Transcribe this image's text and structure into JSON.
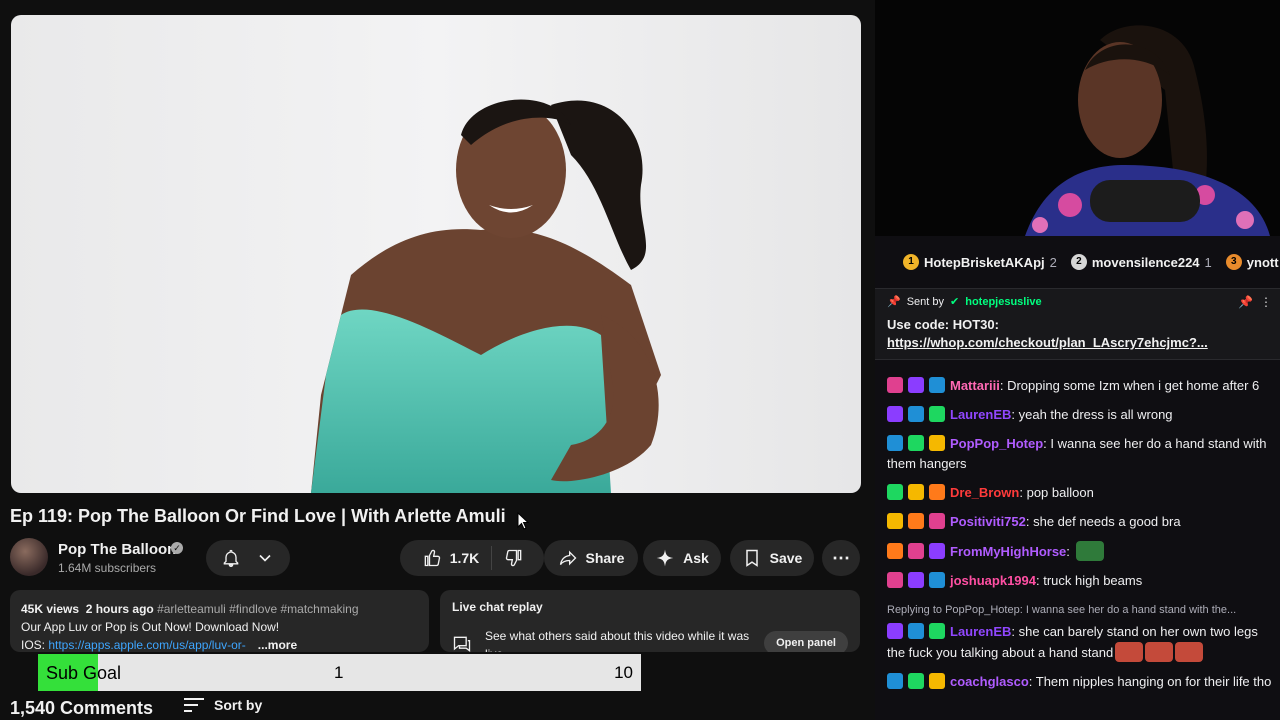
{
  "video": {
    "title": "Ep 119: Pop The Balloon Or Find Love | With Arlette Amuli",
    "channel_name": "Pop The Balloon",
    "subscribers": "1.64M subscribers",
    "like_count": "1.7K",
    "share_label": "Share",
    "ask_label": "Ask",
    "save_label": "Save",
    "more_label": "⋯"
  },
  "description": {
    "views": "45K views",
    "age": "2 hours ago",
    "tags": "#arletteamuli #findlove #matchmaking",
    "line2": "Our App Luv or Pop is Out Now! Download Now!",
    "ios_label": "IOS: ",
    "ios_link": "https://apps.apple.com/us/app/luv-or-",
    "more": "...more"
  },
  "live_chat_replay": {
    "title": "Live chat replay",
    "text": "See what others said about this video while it was live.",
    "button": "Open panel"
  },
  "sub_goal": {
    "label": "Sub Goal",
    "current": "1",
    "target": "10",
    "fill_fraction": 0.1,
    "fill_color": "#34e03a"
  },
  "comments": {
    "count": "1,540 Comments",
    "sort_label": "Sort by"
  },
  "chat": {
    "leaderboard": [
      {
        "rank": "1",
        "name": "HotepBrisketAKApj",
        "count": "2",
        "color": "#f0b429"
      },
      {
        "rank": "2",
        "name": "movensilence224",
        "count": "1",
        "color": "#d6d6d6"
      },
      {
        "rank": "3",
        "name": "ynott",
        "count": "",
        "color": "#e88b2c"
      }
    ],
    "pinned": {
      "sent_by": "Sent by",
      "user": "hotepjesuslive",
      "line1": "Use code: HOT30:",
      "link": "https://whop.com/checkout/plan_LAscry7ehcjmc?..."
    },
    "messages": [
      {
        "user": "Mattariii",
        "color": "#ff69b4",
        "text": ": Dropping some Izm when i get home after 6"
      },
      {
        "user": "LaurenEB",
        "color": "#9147ff",
        "text": ": yeah the dress is all wrong"
      },
      {
        "user": "PopPop_Hotep",
        "color": "#b05cff",
        "text": ": I wanna see her do a hand stand with them hangers"
      },
      {
        "user": "Dre_Brown",
        "color": "#ff3b3b",
        "text": ": pop balloon"
      },
      {
        "user": "Positiviti752",
        "color": "#b05cff",
        "text": ": she def needs a good bra"
      },
      {
        "user": "FromMyHighHorse",
        "color": "#b05cff",
        "text": ": "
      },
      {
        "user": "joshuapk1994",
        "color": "#ff4fa3",
        "text": ": truck high beams"
      },
      {
        "reply": "Replying to PopPop_Hotep: I wanna see her do a hand stand with the...",
        "user": "LaurenEB",
        "color": "#9147ff",
        "text": ": she can barely stand on her own two legs the fuck you talking about a hand stand"
      },
      {
        "user": "coachglasco",
        "color": "#b05cff",
        "text": ": Them nipples hanging on for their life tho"
      }
    ]
  }
}
